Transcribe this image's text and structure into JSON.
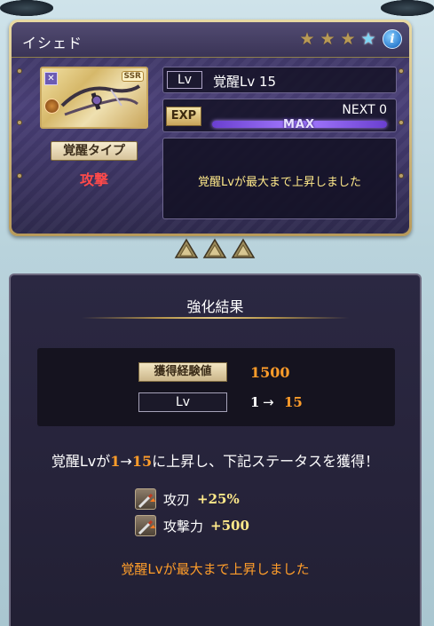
{
  "weapon": {
    "name": "イシェド",
    "rarity": "SSR",
    "stars_total": 4,
    "stars_gold": 3,
    "stars_blue": 1,
    "awaken_type_label": "覚醒タイプ",
    "awaken_type_value": "攻撃",
    "lv_tag": "Lv",
    "lv_text": "覚醒Lv 15",
    "exp_tag": "EXP",
    "next_text": "NEXT 0",
    "exp_progress_percent": 100,
    "max_label": "MAX",
    "message": "覚醒Lvが最大まで上昇しました"
  },
  "result": {
    "title": "強化結果",
    "exp_gain_label": "獲得経験値",
    "exp_gain_value": "1500",
    "lv_label": "Lv",
    "lv_from": "1",
    "lv_arrow": "→",
    "lv_to": "15",
    "summary_prefix": "覚醒Lvが",
    "summary_from": "1",
    "summary_arrow": "→",
    "summary_to": "15",
    "summary_suffix": "に上昇し、下記ステータスを獲得！",
    "bonuses": [
      {
        "name": "攻刃",
        "value": "+25%",
        "icon": "sword-up-icon"
      },
      {
        "name": "攻撃力",
        "value": "+500",
        "icon": "sword-up-icon"
      }
    ],
    "final_message": "覚醒Lvが最大まで上昇しました"
  },
  "colors": {
    "accent_orange": "#ff9d2a",
    "accent_yellow": "#ffe98a",
    "attack_red": "#ff4a4a",
    "exp_bar_purple": "#8a5cf0"
  }
}
